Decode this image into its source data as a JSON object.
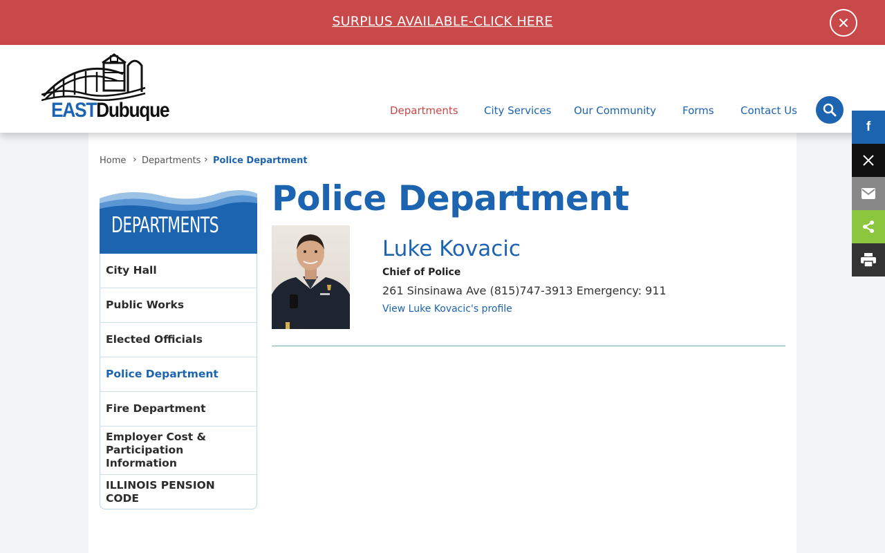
{
  "alert": {
    "link_text": "SURPLUS AVAILABLE-CLICK HERE",
    "close_icon": "close-icon"
  },
  "logo": {
    "east": "EAST",
    "dubuque": "Dubuque"
  },
  "nav": {
    "items": [
      {
        "label": "Departments",
        "active": true
      },
      {
        "label": "City Services"
      },
      {
        "label": "Our Community"
      },
      {
        "label": "Forms"
      },
      {
        "label": "Contact Us"
      }
    ],
    "search_icon": "search-icon"
  },
  "share": [
    {
      "name": "facebook",
      "glyph": "f",
      "color": "#1c63b0"
    },
    {
      "name": "x",
      "glyph": "𝕏",
      "color": "#111111"
    },
    {
      "name": "email",
      "glyph": "✉",
      "color": "#888888"
    },
    {
      "name": "sharethis",
      "glyph": "share",
      "color": "#8cc63f"
    },
    {
      "name": "print",
      "glyph": "print",
      "color": "#333333"
    }
  ],
  "breadcrumb": {
    "home": "Home",
    "departments": "Departments",
    "current": "Police Department",
    "separator": "›"
  },
  "sidebar": {
    "title": "DEPARTMENTS",
    "items": [
      {
        "label": "City Hall"
      },
      {
        "label": "Public Works"
      },
      {
        "label": "Elected Officials"
      },
      {
        "label": "Police Department",
        "current": true
      },
      {
        "label": "Fire Department"
      },
      {
        "label": "Employer Cost & Participation Information"
      },
      {
        "label": "ILLINOIS PENSION CODE"
      }
    ]
  },
  "main": {
    "title": "Police Department",
    "person": {
      "name": "Luke Kovacic",
      "role": "Chief of Police",
      "contact": "261 Sinsinawa Ave (815)747-3913 Emergency: 911",
      "profile_link": "View Luke Kovacic's profile"
    }
  },
  "colors": {
    "brand_blue": "#1c63b0",
    "alert_red": "#c9484a",
    "active_nav": "#c9484a"
  }
}
